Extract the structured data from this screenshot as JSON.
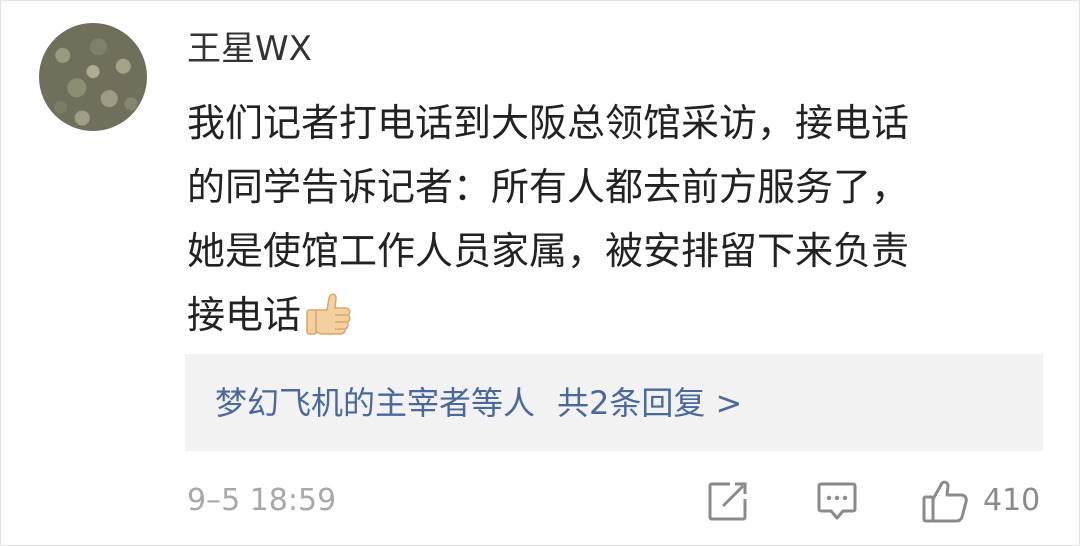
{
  "comment": {
    "author": "王星WX",
    "lines": [
      "我们记者打电话到大阪总领馆采访，接电话",
      "的同学告诉记者：所有人都去前方服务了，",
      "她是使馆工作人员家属，被安排留下来负责",
      "接电话"
    ],
    "emoji": "thumbs-up-emoji",
    "replies": {
      "who": "梦幻飞机的主宰者等人",
      "count_label": "共2条回复 >"
    },
    "timestamp": "9–5 18:59",
    "actions": {
      "edit_icon": "edit-icon",
      "comment_icon": "comment-icon",
      "like_icon": "thumbs-up-icon",
      "like_count": "410"
    }
  },
  "colors": {
    "link": "#49689c",
    "reply_box_bg": "#f2f2f2",
    "meta_text": "#a8a8a8"
  }
}
